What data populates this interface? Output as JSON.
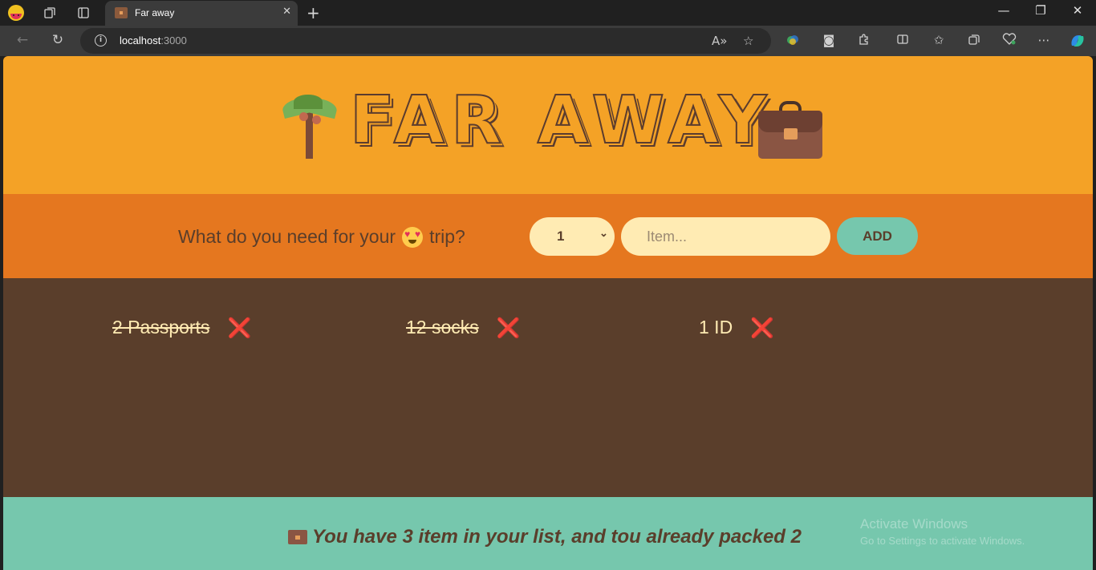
{
  "browser": {
    "tab_title": "Far away",
    "tab_close": "✕",
    "new_tab": "+",
    "url_host": "localhost",
    "url_port": ":3000"
  },
  "app": {
    "logo_text": "FAR AWAY",
    "form": {
      "question_prefix": "What do you need for your",
      "question_suffix": "trip?",
      "quantity_value": "1",
      "item_placeholder": "Item...",
      "add_label": "ADD"
    },
    "items": [
      {
        "label": "2 Passports",
        "packed": true,
        "delete_icon": "❌"
      },
      {
        "label": "12 socks",
        "packed": true,
        "delete_icon": "❌"
      },
      {
        "label": "1 ID",
        "packed": false,
        "delete_icon": "❌"
      }
    ],
    "stats_text": "You have 3 item in your list, and tou already packed 2"
  },
  "watermark": {
    "line1": "Activate Windows",
    "line2": "Go to Settings to activate Windows."
  },
  "colors": {
    "header_bg": "#f4a226",
    "form_bg": "#e5771f",
    "list_bg": "#5a3e2b",
    "stats_bg": "#76c7ad",
    "cream": "#ffebb3",
    "delete_red": "#e2315a"
  }
}
